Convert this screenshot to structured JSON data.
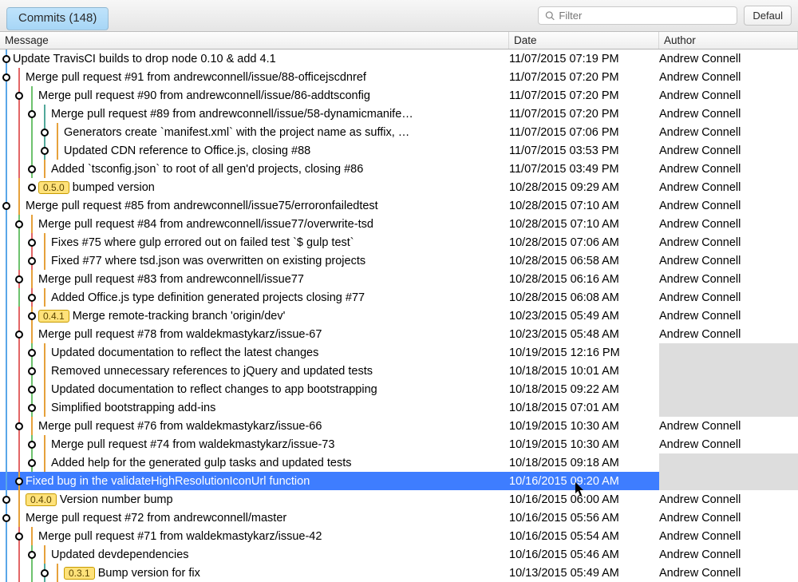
{
  "toolbar": {
    "tab_label": "Commits (148)",
    "filter_placeholder": "Filter",
    "default_button": "Defaul"
  },
  "columns": {
    "message": "Message",
    "date": "Date",
    "author": "Author"
  },
  "commits": [
    {
      "message": "Update TravisCI builds to drop node 0.10 & add 4.1",
      "date": "11/07/2015 07:19 PM",
      "author": "Andrew Connell",
      "indent": 1,
      "trackColors": [
        "blue"
      ],
      "selected": false,
      "tag": null
    },
    {
      "message": "Merge pull request #91 from andrewconnell/issue/88-officejscdnref",
      "date": "11/07/2015 07:20 PM",
      "author": "Andrew Connell",
      "indent": 1,
      "trackColors": [
        "blue",
        "red"
      ],
      "selected": false,
      "tag": null
    },
    {
      "message": "Merge pull request #90 from andrewconnell/issue/86-addtsconfig",
      "date": "11/07/2015 07:20 PM",
      "author": "Andrew Connell",
      "indent": 2,
      "trackColors": [
        "blue",
        "red",
        "green"
      ],
      "selected": false,
      "tag": null
    },
    {
      "message": "Merge pull request #89 from andrewconnell/issue/58-dynamicmanife…",
      "date": "11/07/2015 07:20 PM",
      "author": "Andrew Connell",
      "indent": 3,
      "trackColors": [
        "blue",
        "red",
        "green",
        "irish"
      ],
      "selected": false,
      "tag": null
    },
    {
      "message": "Generators create `manifest.xml` with the project name as suffix, …",
      "date": "11/07/2015 07:06 PM",
      "author": "Andrew Connell",
      "indent": 4,
      "trackColors": [
        "blue",
        "red",
        "green",
        "irish",
        "orange"
      ],
      "selected": false,
      "tag": null
    },
    {
      "message": "Updated CDN reference to Office.js, closing #88",
      "date": "11/07/2015 03:53 PM",
      "author": "Andrew Connell",
      "indent": 4,
      "trackColors": [
        "blue",
        "red",
        "green",
        "irish",
        "orange"
      ],
      "selected": false,
      "tag": null
    },
    {
      "message": "Added `tsconfig.json` to root of all gen'd projects, closing #86",
      "date": "11/07/2015 03:49 PM",
      "author": "Andrew Connell",
      "indent": 3,
      "trackColors": [
        "blue",
        "red",
        "green",
        "orange"
      ],
      "selected": false,
      "tag": null
    },
    {
      "message": "bumped version",
      "date": "10/28/2015 09:29 AM",
      "author": "Andrew Connell",
      "indent": 3,
      "trackColors": [
        "blue",
        "orange"
      ],
      "selected": false,
      "tag": "0.5.0"
    },
    {
      "message": "Merge pull request #85 from andrewconnell/issue75/erroronfailedtest",
      "date": "10/28/2015 07:10 AM",
      "author": "Andrew Connell",
      "indent": 1,
      "trackColors": [
        "blue",
        "orange"
      ],
      "selected": false,
      "tag": null
    },
    {
      "message": "Merge pull request #84 from andrewconnell/issue77/overwrite-tsd",
      "date": "10/28/2015 07:10 AM",
      "author": "Andrew Connell",
      "indent": 2,
      "trackColors": [
        "blue",
        "green",
        "orange"
      ],
      "selected": false,
      "tag": null
    },
    {
      "message": "Fixes #75 where gulp errored out on failed test `$ gulp test`",
      "date": "10/28/2015 07:06 AM",
      "author": "Andrew Connell",
      "indent": 3,
      "trackColors": [
        "blue",
        "green",
        "red",
        "orange"
      ],
      "selected": false,
      "tag": null
    },
    {
      "message": "Fixed #77 where tsd.json was overwritten on existing projects",
      "date": "10/28/2015 06:58 AM",
      "author": "Andrew Connell",
      "indent": 3,
      "trackColors": [
        "blue",
        "green",
        "red",
        "orange"
      ],
      "selected": false,
      "tag": null
    },
    {
      "message": "Merge pull request #83 from andrewconnell/issue77",
      "date": "10/28/2015 06:16 AM",
      "author": "Andrew Connell",
      "indent": 2,
      "trackColors": [
        "blue",
        "red",
        "orange"
      ],
      "selected": false,
      "tag": null
    },
    {
      "message": "Added Office.js type definition generated projects closing #77",
      "date": "10/28/2015 06:08 AM",
      "author": "Andrew Connell",
      "indent": 3,
      "trackColors": [
        "blue",
        "green",
        "red",
        "orange"
      ],
      "selected": false,
      "tag": null
    },
    {
      "message": "Merge remote-tracking branch 'origin/dev'",
      "date": "10/23/2015 05:49 AM",
      "author": "Andrew Connell",
      "indent": 3,
      "trackColors": [
        "blue",
        "red",
        "orange"
      ],
      "selected": false,
      "tag": "0.4.1"
    },
    {
      "message": "Merge pull request #78 from waldekmastykarz/issue-67",
      "date": "10/23/2015 05:48 AM",
      "author": "Andrew Connell",
      "indent": 2,
      "trackColors": [
        "blue",
        "red",
        "orange"
      ],
      "selected": false,
      "tag": null
    },
    {
      "message": "Updated documentation to reflect the latest changes",
      "date": "10/19/2015 12:16 PM",
      "author": "",
      "indent": 3,
      "trackColors": [
        "blue",
        "red",
        "green",
        "orange"
      ],
      "selected": false,
      "tag": null
    },
    {
      "message": "Removed unnecessary references to jQuery and updated tests",
      "date": "10/18/2015 10:01 AM",
      "author": "",
      "indent": 3,
      "trackColors": [
        "blue",
        "red",
        "green",
        "orange"
      ],
      "selected": false,
      "tag": null
    },
    {
      "message": "Updated documentation to reflect changes to app bootstrapping",
      "date": "10/18/2015 09:22 AM",
      "author": "",
      "indent": 3,
      "trackColors": [
        "blue",
        "red",
        "green",
        "orange"
      ],
      "selected": false,
      "tag": null
    },
    {
      "message": "Simplified bootstrapping add-ins",
      "date": "10/18/2015 07:01 AM",
      "author": "",
      "indent": 3,
      "trackColors": [
        "blue",
        "red",
        "green",
        "orange"
      ],
      "selected": false,
      "tag": null
    },
    {
      "message": "Merge pull request #76 from waldekmastykarz/issue-66",
      "date": "10/19/2015 10:30 AM",
      "author": "Andrew Connell",
      "indent": 2,
      "trackColors": [
        "blue",
        "red",
        "orange"
      ],
      "selected": false,
      "tag": null
    },
    {
      "message": "Merge pull request #74 from waldekmastykarz/issue-73",
      "date": "10/19/2015 10:30 AM",
      "author": "Andrew Connell",
      "indent": 3,
      "trackColors": [
        "blue",
        "red",
        "green",
        "orange"
      ],
      "selected": false,
      "tag": null
    },
    {
      "message": "Added help for the generated gulp tasks and updated tests",
      "date": "10/18/2015 09:18 AM",
      "author": "",
      "indent": 3,
      "trackColors": [
        "blue",
        "red",
        "green",
        "orange"
      ],
      "selected": false,
      "tag": null
    },
    {
      "message": "Fixed bug in the validateHighResolutionIconUrl function",
      "date": "10/16/2015 09:20 AM",
      "author": "",
      "indent": 2,
      "trackColors": [
        "blue",
        "orange"
      ],
      "selected": true,
      "tag": null
    },
    {
      "message": "Version number bump",
      "date": "10/16/2015 06:00 AM",
      "author": "Andrew Connell",
      "indent": 1,
      "trackColors": [
        "blue",
        "orange"
      ],
      "selected": false,
      "tag": "0.4.0"
    },
    {
      "message": "Merge pull request #72 from andrewconnell/master",
      "date": "10/16/2015 05:56 AM",
      "author": "Andrew Connell",
      "indent": 1,
      "trackColors": [
        "blue",
        "orange"
      ],
      "selected": false,
      "tag": null
    },
    {
      "message": "Merge pull request #71 from waldekmastykarz/issue-42",
      "date": "10/16/2015 05:54 AM",
      "author": "Andrew Connell",
      "indent": 2,
      "trackColors": [
        "blue",
        "red",
        "orange"
      ],
      "selected": false,
      "tag": null
    },
    {
      "message": "Updated devdependencies",
      "date": "10/16/2015 05:46 AM",
      "author": "Andrew Connell",
      "indent": 3,
      "trackColors": [
        "blue",
        "red",
        "green",
        "orange"
      ],
      "selected": false,
      "tag": null
    },
    {
      "message": "Bump version for fix",
      "date": "10/13/2015 05:49 AM",
      "author": "Andrew Connell",
      "indent": 4,
      "trackColors": [
        "blue",
        "red",
        "green",
        "irish",
        "orange"
      ],
      "selected": false,
      "tag": "0.3.1"
    }
  ],
  "colorMap": {
    "blue": "#5aa7e8",
    "red": "#e36666",
    "green": "#6ec26e",
    "irish": "#52a89a",
    "orange": "#e6a13b"
  }
}
